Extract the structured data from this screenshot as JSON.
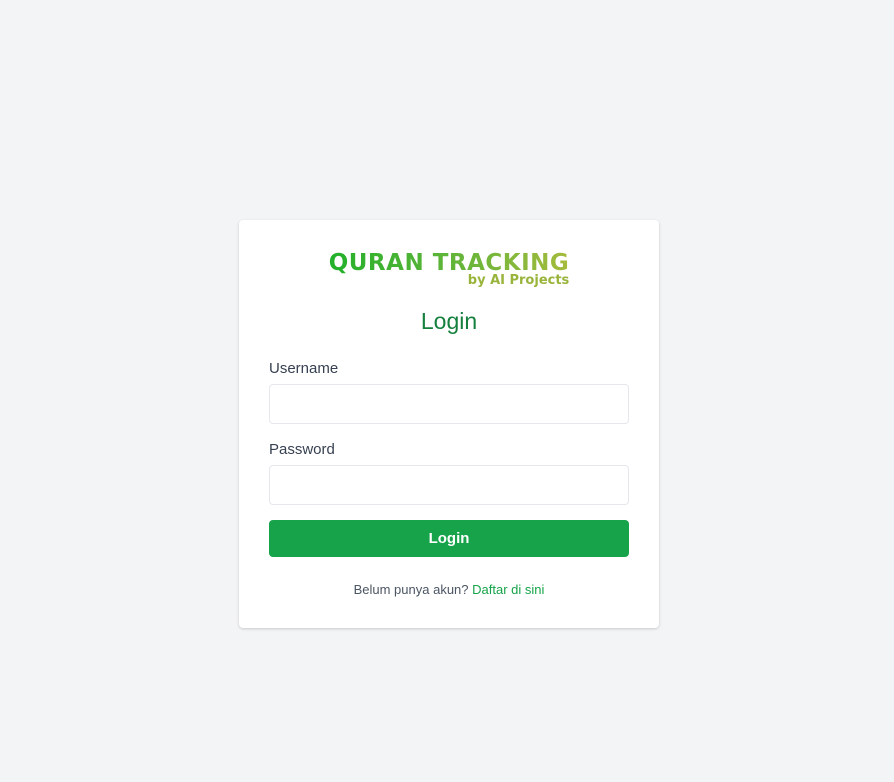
{
  "logo": {
    "main": "QURAN TRACKING",
    "sub": "by AI Projects"
  },
  "form": {
    "title": "Login",
    "username_label": "Username",
    "username_value": "",
    "password_label": "Password",
    "password_value": "",
    "submit_label": "Login"
  },
  "register": {
    "prompt": "Belum punya akun?",
    "link_label": "Daftar di sini"
  },
  "colors": {
    "accent": "#16a34a",
    "title": "#15803d",
    "background": "#f3f4f6"
  }
}
